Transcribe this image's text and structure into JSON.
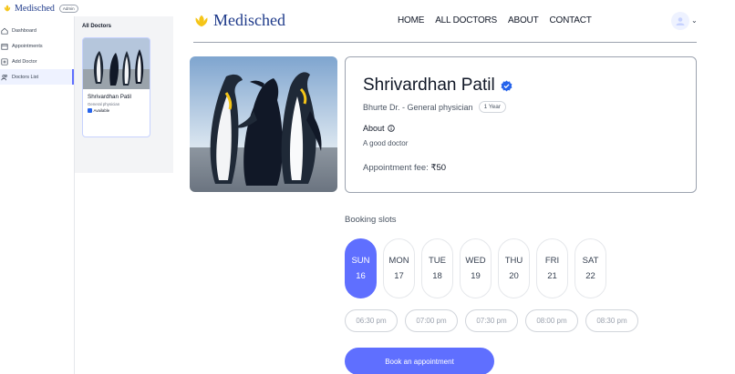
{
  "admin": {
    "brand": "Medisched",
    "badge": "Admin",
    "sidebar": [
      {
        "label": "Dashboard",
        "icon": "home-icon"
      },
      {
        "label": "Appointments",
        "icon": "calendar-icon"
      },
      {
        "label": "Add Doctor",
        "icon": "add-square-icon"
      },
      {
        "label": "Doctors List",
        "icon": "people-icon",
        "active": true
      }
    ],
    "main_title": "All Doctors",
    "doctor_card": {
      "name": "Shrivardhan Patil",
      "speciality": "General physician",
      "availability": "Available",
      "checked": true
    }
  },
  "site": {
    "brand": "Medisched",
    "nav": [
      "HOME",
      "ALL DOCTORS",
      "ABOUT",
      "CONTACT"
    ],
    "doctor": {
      "name": "Shrivardhan Patil",
      "meta": "Bhurte Dr. - General physician",
      "experience": "1 Year",
      "about_label": "About",
      "about_text": "A good doctor",
      "fee_label": "Appointment fee:",
      "fee_value": "₹50"
    },
    "slots_title": "Booking slots",
    "days": [
      {
        "day": "SUN",
        "date": "16",
        "active": true
      },
      {
        "day": "MON",
        "date": "17"
      },
      {
        "day": "TUE",
        "date": "18"
      },
      {
        "day": "WED",
        "date": "19"
      },
      {
        "day": "THU",
        "date": "20"
      },
      {
        "day": "FRI",
        "date": "21"
      },
      {
        "day": "SAT",
        "date": "22"
      }
    ],
    "times": [
      "06:30 pm",
      "07:00 pm",
      "07:30 pm",
      "08:00 pm",
      "08:30 pm"
    ],
    "book_button": "Book an appointment"
  },
  "colors": {
    "primary": "#5f6fff",
    "brand_text": "#1e3a8a",
    "logo": "#f5c518"
  }
}
